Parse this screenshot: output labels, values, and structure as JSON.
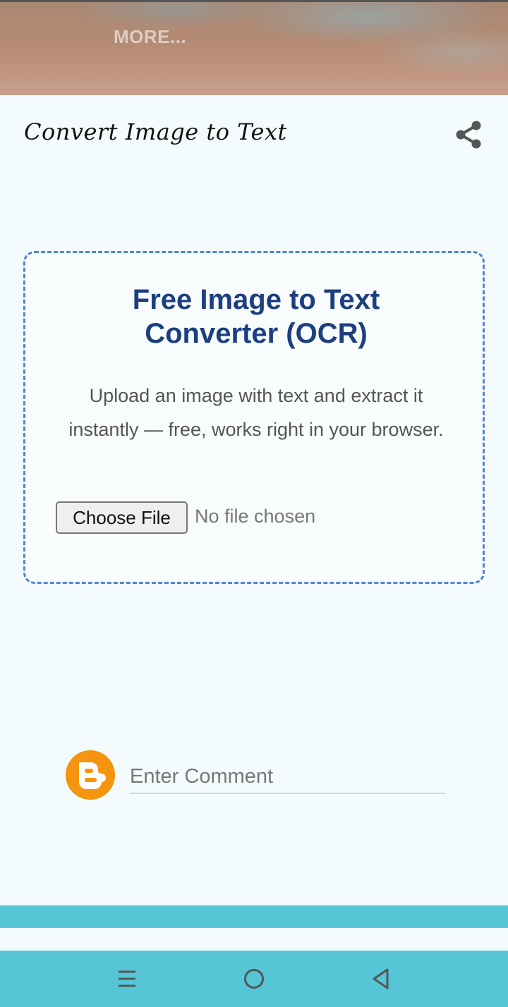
{
  "banner": {
    "more_label": "MORE..."
  },
  "header": {
    "title": "Convert Image to Text"
  },
  "card": {
    "heading_line1": "Free Image to Text",
    "heading_line2": "Converter (OCR)",
    "description": "Upload an image with text and extract it instantly — free, works right in your browser.",
    "choose_file_label": "Choose File",
    "file_status": "No file chosen"
  },
  "comment": {
    "placeholder": "Enter Comment"
  },
  "icons": {
    "share": "share-icon",
    "blogger": "blogger-icon",
    "menu": "menu-icon",
    "home": "home-icon",
    "back": "back-icon"
  },
  "colors": {
    "heading": "#1d3f80",
    "card_border": "#4f86cf",
    "nav_bar": "#56c6d6",
    "blogger_orange": "#f4940f"
  }
}
